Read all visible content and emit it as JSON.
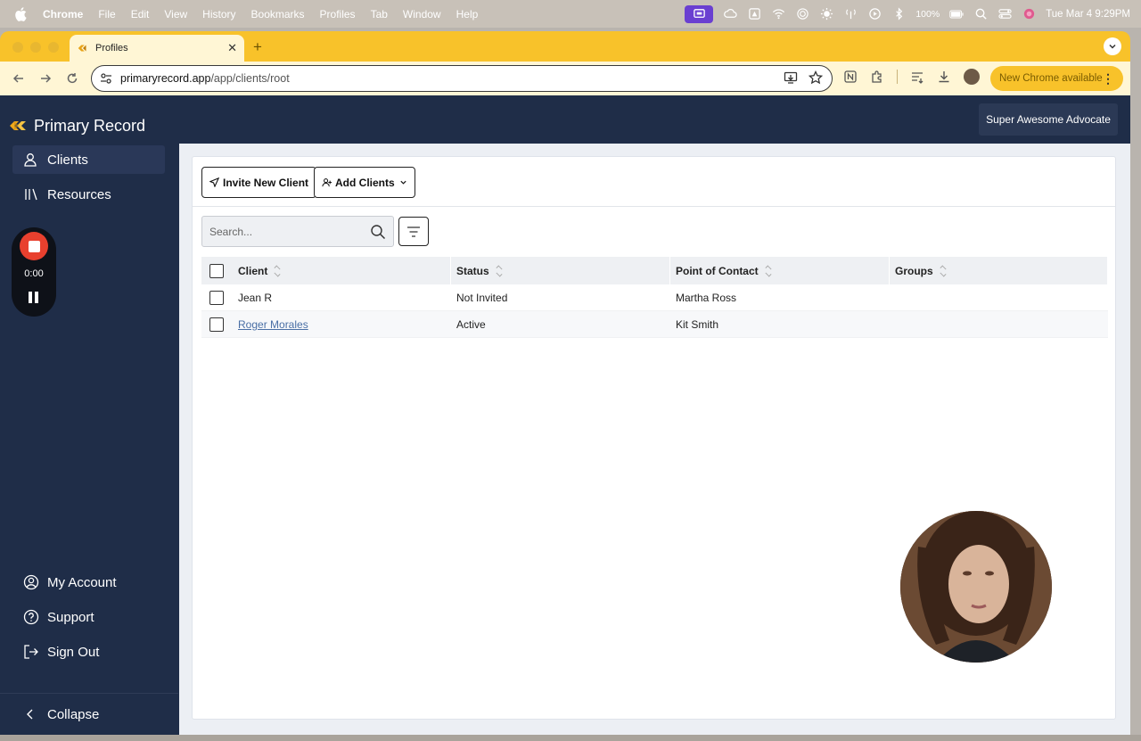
{
  "menubar": {
    "app": "Chrome",
    "items": [
      "File",
      "Edit",
      "View",
      "History",
      "Bookmarks",
      "Profiles",
      "Tab",
      "Window",
      "Help"
    ],
    "battery": "100%",
    "datetime": "Tue Mar 4  9:29PM"
  },
  "browser": {
    "tab_title": "Profiles",
    "url_host": "primaryrecord.app",
    "url_path": "/app/clients/root",
    "update_label": "New Chrome available"
  },
  "app": {
    "brand": "Primary Record",
    "user_name": "Super Awesome Advocate",
    "nav": [
      {
        "label": "Clients",
        "icon": "users-icon"
      },
      {
        "label": "Resources",
        "icon": "books-icon"
      }
    ],
    "recorder_time": "0:00",
    "bottom_nav": [
      {
        "label": "My Account",
        "icon": "user-circle-icon"
      },
      {
        "label": "Support",
        "icon": "help-icon"
      },
      {
        "label": "Sign Out",
        "icon": "sign-out-icon"
      }
    ],
    "collapse_label": "Collapse",
    "colors": {
      "sidebar": "#1f2d48",
      "accent": "#f8c22a",
      "link": "#4a6fa5",
      "record": "#e8402e"
    }
  },
  "toolbar": {
    "invite_label": "Invite New Client",
    "add_label": "Add Clients"
  },
  "search": {
    "placeholder": "Search..."
  },
  "table": {
    "headers": [
      "Client",
      "Status",
      "Point of Contact",
      "Groups"
    ],
    "rows": [
      {
        "client": "Jean R",
        "status": "Not Invited",
        "contact": "Martha Ross",
        "groups": ""
      },
      {
        "client": "Roger Morales",
        "status": "Active",
        "contact": "Kit Smith",
        "groups": ""
      }
    ]
  }
}
